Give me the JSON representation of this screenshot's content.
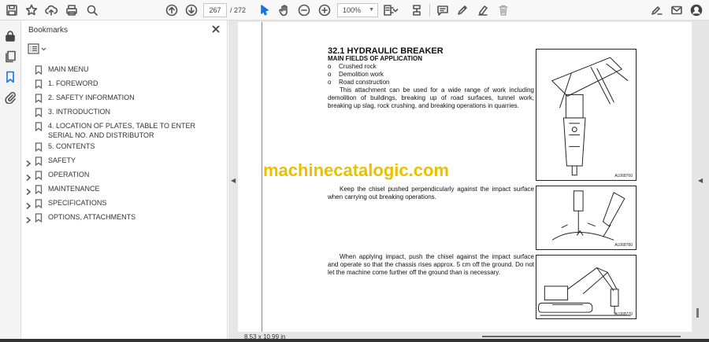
{
  "toolbar": {
    "current_page": "267",
    "total_pages": "/ 272",
    "zoom": "100%"
  },
  "bookmarks": {
    "title": "Bookmarks",
    "items": [
      {
        "label": "MAIN MENU",
        "expandable": false
      },
      {
        "label": "1. FOREWORD",
        "expandable": false
      },
      {
        "label": "2. SAFETY INFORMATION",
        "expandable": false
      },
      {
        "label": "3. INTRODUCTION",
        "expandable": false
      },
      {
        "label": "4. LOCATION OF PLATES, TABLE TO ENTER SERIAL NO. AND DISTRIBUTOR",
        "expandable": false
      },
      {
        "label": "5. CONTENTS",
        "expandable": false
      },
      {
        "label": "SAFETY",
        "expandable": true
      },
      {
        "label": "OPERATION",
        "expandable": true
      },
      {
        "label": "MAINTENANCE",
        "expandable": true
      },
      {
        "label": "SPECIFICATIONS",
        "expandable": true
      },
      {
        "label": "OPTIONS, ATTACHMENTS",
        "expandable": true
      }
    ]
  },
  "document": {
    "heading": "32.1  HYDRAULIC BREAKER",
    "subheading": "MAIN FIELDS OF APPLICATION",
    "bullets": [
      {
        "marker": "o",
        "text": "Crushed rock"
      },
      {
        "marker": "o",
        "text": "Demolition work"
      },
      {
        "marker": "o",
        "text": "Road construction"
      }
    ],
    "paragraph1": "This attachment can be used for a wide range of work including demolition of buildings, breaking up of road surfaces, tunnel work, breaking up slag, rock crushing, and breaking operations in quarries.",
    "paragraph2": "Keep the chisel pushed perpendicularly against the impact surface when carrying out breaking operations.",
    "paragraph3": "When applying impact, push the chisel against the impact surface and operate so that the chassis rises approx. 5 cm off the ground. Do not let the machine come further off the ground than is necessary.",
    "figure_codes": [
      "AL068760",
      "AL068780",
      "AL068770"
    ],
    "watermark": "machinecatalogic.com"
  },
  "status": {
    "page_size": "8.53 x 10.99 in"
  },
  "colors": {
    "accent": "#1473e6",
    "watermark": "#e6c200"
  }
}
